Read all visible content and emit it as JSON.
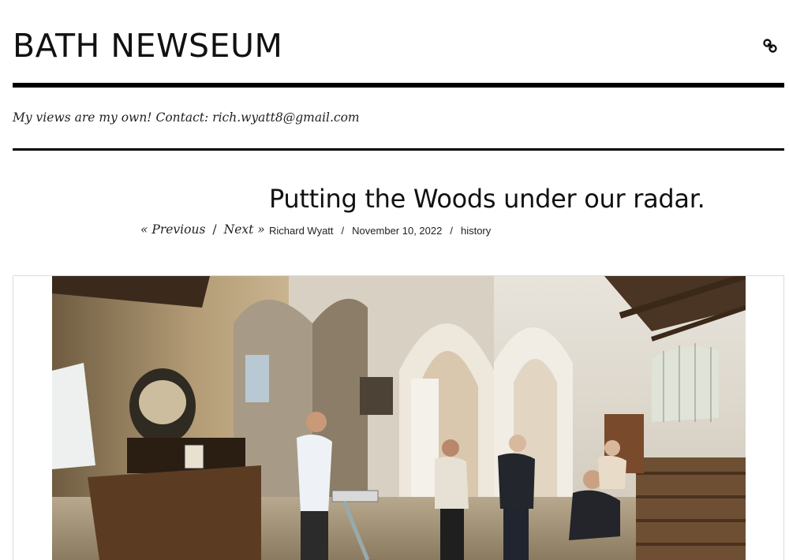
{
  "site": {
    "title": "BATH NEWSEUM",
    "tagline": "My views are my own! Contact: rich.wyatt8@gmail.com"
  },
  "header": {
    "link_icon": "link-icon"
  },
  "post": {
    "title": "Putting the Woods under our radar.",
    "author": "Richard Wyatt",
    "date": "November 10, 2022",
    "category": "history",
    "meta_separator": "/"
  },
  "pagination": {
    "previous_label": "« Previous",
    "separator": "/",
    "next_label": "Next »"
  },
  "colors": {
    "rule": "#000000",
    "text": "#111111",
    "background": "#ffffff"
  }
}
